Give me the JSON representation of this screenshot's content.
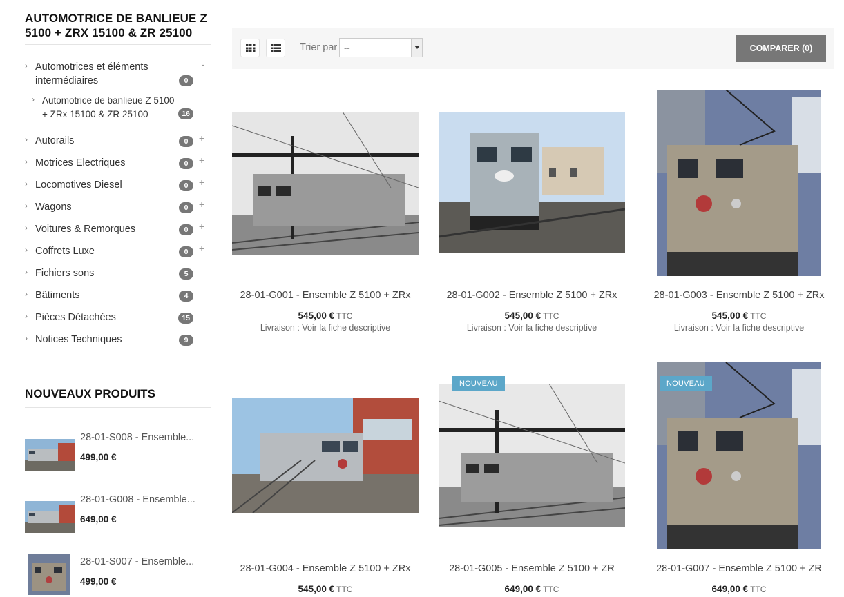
{
  "category": {
    "title": "AUTOMOTRICE DE BANLIEUE Z 5100 + ZRX 15100 & ZR 25100"
  },
  "sidebar": {
    "items": [
      {
        "label": "Automotrices et éléments intermédiaires",
        "count": "0",
        "toggle": "-"
      },
      {
        "label": "Automotrice de banlieue Z 5100 + ZRx 15100 & ZR 25100",
        "count": "16",
        "toggle": ""
      },
      {
        "label": "Autorails",
        "count": "0",
        "toggle": "+"
      },
      {
        "label": "Motrices Electriques",
        "count": "0",
        "toggle": "+"
      },
      {
        "label": "Locomotives Diesel",
        "count": "0",
        "toggle": "+"
      },
      {
        "label": "Wagons",
        "count": "0",
        "toggle": "+"
      },
      {
        "label": "Voitures & Remorques",
        "count": "0",
        "toggle": "+"
      },
      {
        "label": "Coffrets Luxe",
        "count": "0",
        "toggle": "+"
      },
      {
        "label": "Fichiers sons",
        "count": "5",
        "toggle": ""
      },
      {
        "label": "Bâtiments",
        "count": "4",
        "toggle": ""
      },
      {
        "label": "Pièces Détachées",
        "count": "15",
        "toggle": ""
      },
      {
        "label": "Notices Techniques",
        "count": "9",
        "toggle": ""
      }
    ]
  },
  "new_products": {
    "title": "NOUVEAUX PRODUITS",
    "items": [
      {
        "name": "28-01-S008 - Ensemble...",
        "price": "499,00 €"
      },
      {
        "name": "28-01-G008 - Ensemble...",
        "price": "649,00 €"
      },
      {
        "name": "28-01-S007 - Ensemble...",
        "price": "499,00 €"
      }
    ]
  },
  "toolbar": {
    "sort_label": "Trier par",
    "sort_value": "--",
    "compare_label": "COMPARER (0)"
  },
  "products": [
    {
      "name": "28-01-G001 - Ensemble Z 5100 + ZRx",
      "price": "545,00 €",
      "ttc": "TTC",
      "delivery": "Livraison : Voir la fiche descriptive",
      "tag": ""
    },
    {
      "name": "28-01-G002 - Ensemble Z 5100 + ZRx",
      "price": "545,00 €",
      "ttc": "TTC",
      "delivery": "Livraison : Voir la fiche descriptive",
      "tag": ""
    },
    {
      "name": "28-01-G003 - Ensemble Z 5100 + ZRx",
      "price": "545,00 €",
      "ttc": "TTC",
      "delivery": "Livraison : Voir la fiche descriptive",
      "tag": ""
    },
    {
      "name": "28-01-G004 - Ensemble Z 5100 + ZRx",
      "price": "545,00 €",
      "ttc": "TTC",
      "delivery": "",
      "tag": ""
    },
    {
      "name": "28-01-G005 - Ensemble Z 5100 + ZR",
      "price": "649,00 €",
      "ttc": "TTC",
      "delivery": "",
      "tag": "NOUVEAU"
    },
    {
      "name": "28-01-G007 - Ensemble Z 5100 + ZR",
      "price": "649,00 €",
      "ttc": "TTC",
      "delivery": "",
      "tag": "NOUVEAU"
    }
  ],
  "colors": {
    "tag_blue": "#5ca7c9",
    "compare_grey": "#777777",
    "badge_grey": "#777777"
  }
}
